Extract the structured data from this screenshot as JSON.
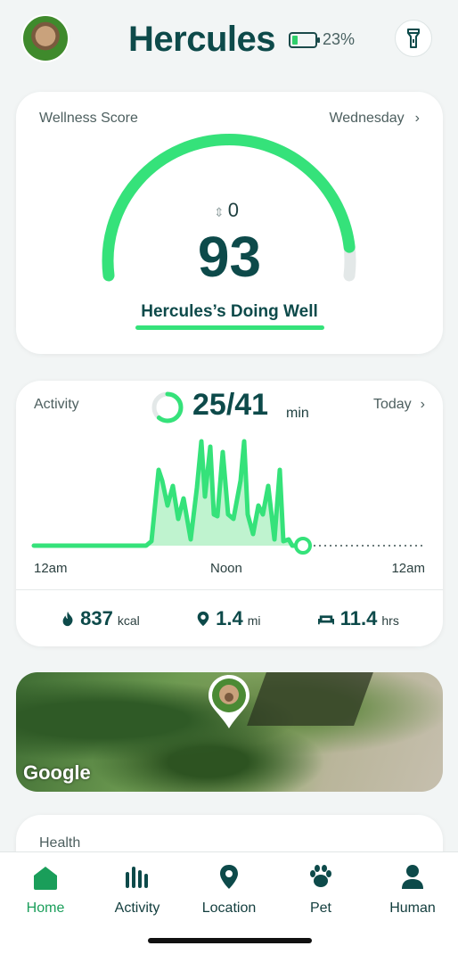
{
  "header": {
    "pet_name": "Hercules",
    "battery_text": "23%",
    "battery_level": 0.23,
    "avatar_icon": "dog-photo",
    "flashlight_icon": "flashlight-icon"
  },
  "wellness": {
    "label": "Wellness Score",
    "day": "Wednesday",
    "change": "0",
    "score": "93",
    "score_value": 93,
    "score_max": 100,
    "status": "Hercules’s Doing Well",
    "accent": "#35e27a"
  },
  "activity": {
    "label": "Activity",
    "minutes": "25/41",
    "minutes_done": 25,
    "minutes_goal": 41,
    "unit": "min",
    "day": "Today",
    "ticks": [
      "12am",
      "Noon",
      "12am"
    ],
    "stats": {
      "calories_value": "837",
      "calories_unit": "kcal",
      "distance_value": "1.4",
      "distance_unit": "mi",
      "rest_value": "11.4",
      "rest_unit": "hrs"
    }
  },
  "map": {
    "attribution": "Google"
  },
  "health": {
    "label": "Health"
  },
  "tabbar": {
    "items": [
      {
        "label": "Home",
        "icon": "home-icon",
        "active": true
      },
      {
        "label": "Activity",
        "icon": "activity-bars-icon",
        "active": false
      },
      {
        "label": "Location",
        "icon": "location-pin-icon",
        "active": false
      },
      {
        "label": "Pet",
        "icon": "paw-icon",
        "active": false
      },
      {
        "label": "Human",
        "icon": "person-icon",
        "active": false
      }
    ]
  },
  "colors": {
    "primary": "#0d4a4a",
    "accent": "#35e27a",
    "active_tab": "#1a9e5a"
  }
}
